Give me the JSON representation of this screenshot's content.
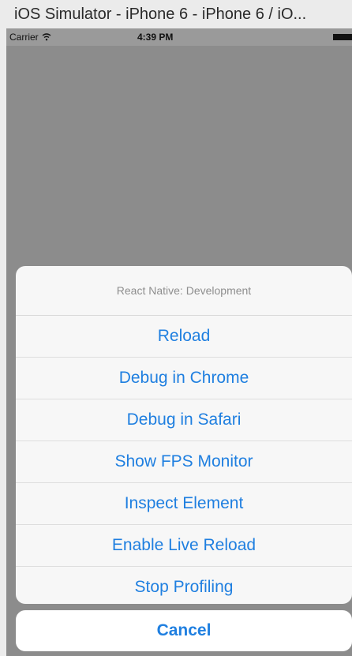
{
  "window": {
    "title": "iOS Simulator - iPhone 6 - iPhone 6 / iO..."
  },
  "status_bar": {
    "carrier": "Carrier",
    "time": "4:39 PM",
    "wifi_icon": "wifi-icon",
    "battery_icon": "battery-icon"
  },
  "action_sheet": {
    "title": "React Native: Development",
    "items": [
      {
        "label": "Reload"
      },
      {
        "label": "Debug in Chrome"
      },
      {
        "label": "Debug in Safari"
      },
      {
        "label": "Show FPS Monitor"
      },
      {
        "label": "Inspect Element"
      },
      {
        "label": "Enable Live Reload"
      },
      {
        "label": "Stop Profiling"
      }
    ],
    "cancel_label": "Cancel"
  },
  "colors": {
    "accent": "#1f7fe0",
    "overlay": "#8c8c8c",
    "sheet_background": "#f7f7f7"
  }
}
